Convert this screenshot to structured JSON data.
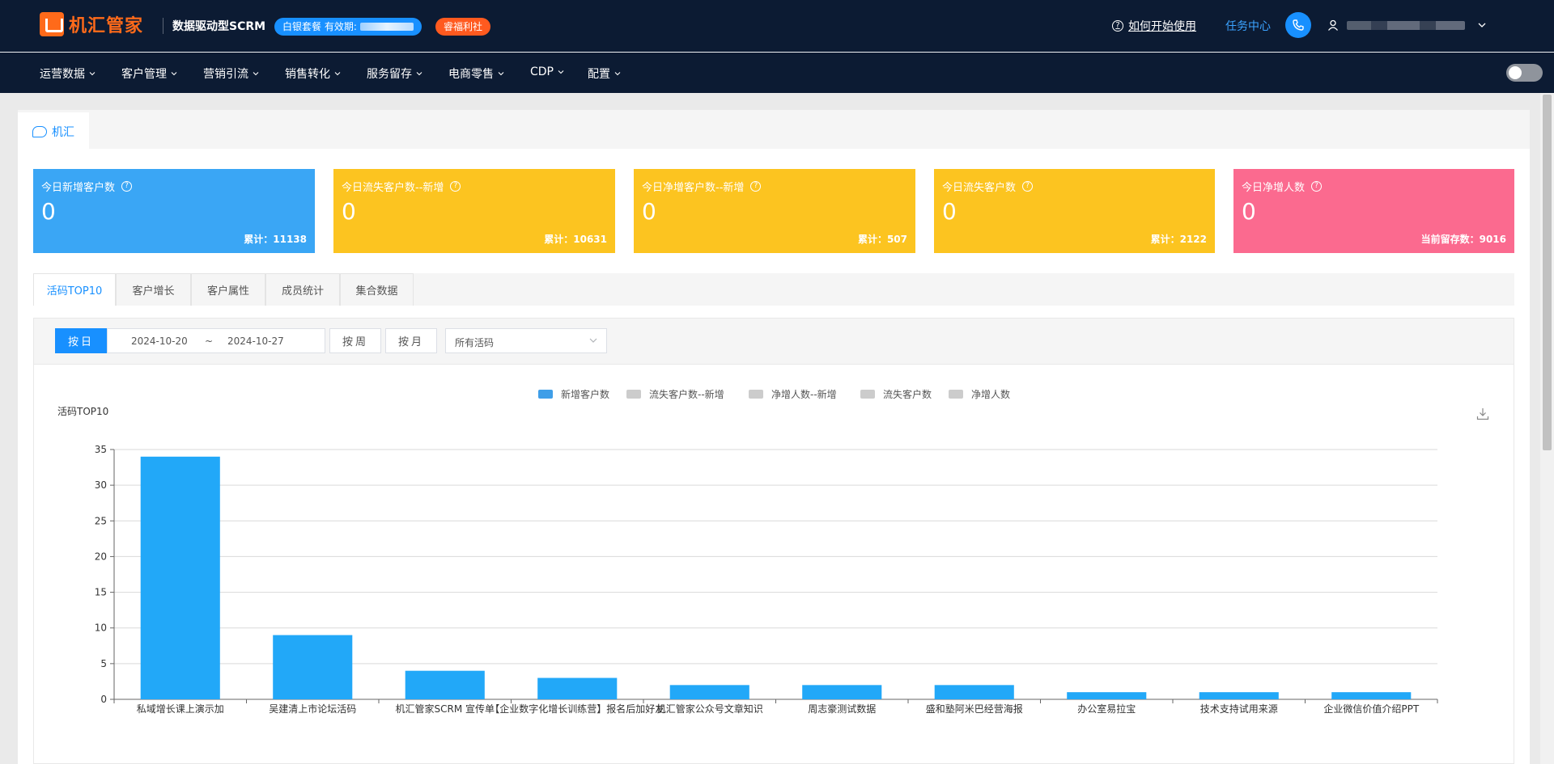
{
  "header": {
    "brand": "机汇管家",
    "slogan": "数据驱动型SCRM",
    "plan_label": "白银套餐 有效期:",
    "welfare_label": "睿福利社",
    "help_link": "如何开始使用",
    "task_center": "任务中心"
  },
  "nav": {
    "items": [
      {
        "label": "运营数据"
      },
      {
        "label": "客户管理"
      },
      {
        "label": "营销引流"
      },
      {
        "label": "销售转化"
      },
      {
        "label": "服务留存"
      },
      {
        "label": "电商零售"
      },
      {
        "label": "CDP"
      },
      {
        "label": "配置"
      }
    ]
  },
  "page_tab": "机汇",
  "stats": [
    {
      "label": "今日新增客户数",
      "value": "0",
      "foot": "累计：11138",
      "color": "#3aa6f5"
    },
    {
      "label": "今日流失客户数--新增",
      "value": "0",
      "foot": "累计：10631",
      "color": "#fcc420"
    },
    {
      "label": "今日净增客户数--新增",
      "value": "0",
      "foot": "累计：507",
      "color": "#fcc420"
    },
    {
      "label": "今日流失客户数",
      "value": "0",
      "foot": "累计：2122",
      "color": "#fcc420"
    },
    {
      "label": "今日净增人数",
      "value": "0",
      "foot": "当前留存数：9016",
      "color": "#fb6a8f"
    }
  ],
  "data_tabs": [
    {
      "label": "活码TOP10",
      "active": true
    },
    {
      "label": "客户增长"
    },
    {
      "label": "客户属性"
    },
    {
      "label": "成员统计"
    },
    {
      "label": "集合数据"
    }
  ],
  "filters": {
    "by_day": "按日",
    "start_date": "2024-10-20",
    "separator": "~",
    "end_date": "2024-10-27",
    "by_week": "按周",
    "by_month": "按月",
    "code_select": "所有活码"
  },
  "legend": [
    {
      "label": "新增客户数",
      "color": "#3f9ee8"
    },
    {
      "label": "流失客户数--新增",
      "color": "#cccccc"
    },
    {
      "label": "净增人数--新增",
      "color": "#cccccc"
    },
    {
      "label": "流失客户数",
      "color": "#cccccc"
    },
    {
      "label": "净增人数",
      "color": "#cccccc"
    }
  ],
  "chart_data": {
    "type": "bar",
    "title": "活码TOP10",
    "categories": [
      "私域增长课上演示加",
      "吴建清上市论坛活码",
      "机汇管家SCRM 宣传单",
      "【企业数字化增长训练营】报名后加好友",
      "机汇管家公众号文章知识",
      "周志豪测试数据",
      "盛和塾阿米巴经营海报",
      "办公室易拉宝",
      "技术支持试用来源",
      "企业微信价值介绍PPT"
    ],
    "series": [
      {
        "name": "新增客户数",
        "values": [
          34,
          9,
          4,
          3,
          2,
          2,
          2,
          1,
          1,
          1
        ],
        "color": "#22a8f8"
      }
    ],
    "ylim": [
      0,
      35
    ],
    "yticks": [
      0,
      5,
      10,
      15,
      20,
      25,
      30,
      35
    ],
    "grid": true,
    "legend_position": "top-center"
  }
}
